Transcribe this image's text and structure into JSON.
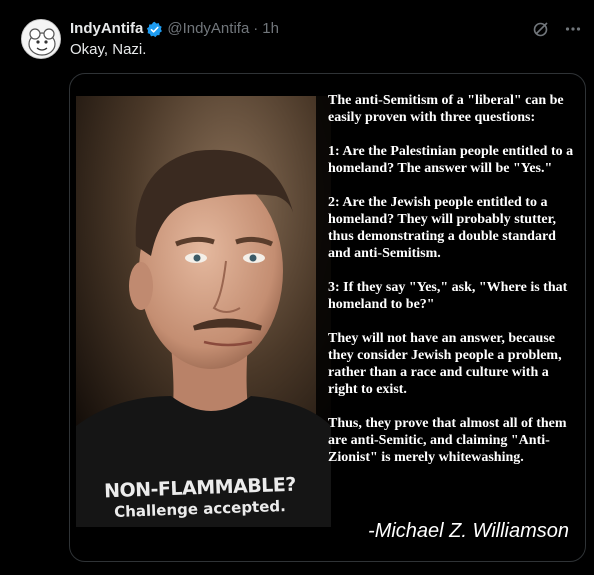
{
  "tweet": {
    "author_name": "IndyAntifa",
    "handle": "@IndyAntifa",
    "separator": "·",
    "time": "1h",
    "text": "Okay, Nazi."
  },
  "colors": {
    "background": "#000000",
    "primary_text": "#e7e9ea",
    "secondary_text": "#71767b",
    "verified_blue": "#1d9bf0",
    "border": "#2f3336"
  },
  "icons": {
    "avatar": "cartoon-avatar",
    "verified": "verified-badge-icon",
    "grok": "grok-icon",
    "more": "more-icon"
  },
  "media": {
    "shirt_line1": "NON-FLAMMABLE?",
    "shirt_line2": "Challenge accepted.",
    "paragraphs": [
      "The anti-Semitism of a \"liberal\" can be easily proven with three questions:",
      "1: Are the Palestinian people entitled to a homeland? The answer will be \"Yes.\"",
      "2: Are the Jewish people entitled to a homeland? They will probably stutter, thus demonstrating a double standard and anti-Semitism.",
      "3: If they say \"Yes,\" ask, \"Where is that homeland to be?\"",
      "They will not have an answer, because they consider Jewish people a problem, rather than a race and culture with a right to exist.",
      "Thus, they prove that almost all of them are anti-Semitic, and claiming \"Anti-Zionist\" is merely whitewashing."
    ],
    "attribution": "-Michael Z. Williamson"
  }
}
